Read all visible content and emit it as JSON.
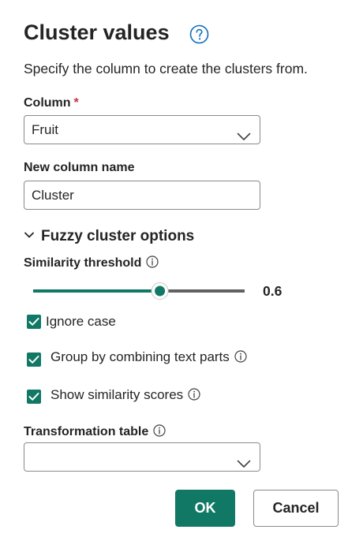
{
  "dialog": {
    "title": "Cluster values",
    "subtitle": "Specify the column to create the clusters from."
  },
  "column": {
    "label": "Column",
    "required_mark": "*",
    "value": "Fruit"
  },
  "new_column": {
    "label": "New column name",
    "value": "Cluster"
  },
  "fuzzy": {
    "section_title": "Fuzzy cluster options",
    "expanded": true,
    "similarity": {
      "label": "Similarity threshold",
      "value": "0.6",
      "fraction": 0.6
    },
    "ignore_case": {
      "label": "Ignore case",
      "checked": true
    },
    "group_by_text_parts": {
      "label": "Group by combining text parts",
      "checked": true
    },
    "show_scores": {
      "label": "Show similarity scores",
      "checked": true
    },
    "transformation_table": {
      "label": "Transformation table",
      "value": ""
    }
  },
  "buttons": {
    "ok": "OK",
    "cancel": "Cancel"
  },
  "colors": {
    "accent": "#117865",
    "required": "#c4314b",
    "help_blue": "#0f6cbd"
  },
  "icons": [
    "help-icon",
    "chevron-down-icon",
    "info-icon",
    "checkmark-icon"
  ]
}
